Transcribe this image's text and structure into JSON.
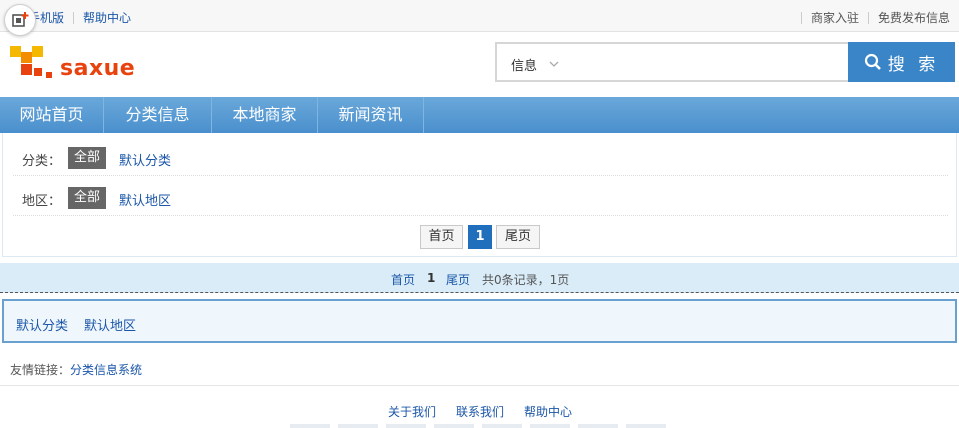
{
  "topbar": {
    "mobile_label": "手机版",
    "help_label": "帮助中心",
    "merchant_join": "商家入驻",
    "free_post": "免费发布信息"
  },
  "header": {
    "logo_text": "saxue",
    "search_category": "信息",
    "search_button": "搜 索",
    "search_placeholder": ""
  },
  "nav": {
    "items": [
      "网站首页",
      "分类信息",
      "本地商家",
      "新闻资讯"
    ]
  },
  "filters": {
    "category": {
      "label": "分类：",
      "all": "全部",
      "option": "默认分类"
    },
    "region": {
      "label": "地区：",
      "all": "全部",
      "option": "默认地区"
    }
  },
  "pager_top": {
    "first": "首页",
    "current": "1",
    "last": "尾页"
  },
  "pager_bar": {
    "first": "首页",
    "current": "1",
    "last": "尾页",
    "summary": "共0条记录，1页"
  },
  "category_links": [
    "默认分类",
    "默认地区"
  ],
  "friend_links": {
    "label": "友情链接：",
    "link": "分类信息系统"
  },
  "footer_links": [
    "关于我们",
    "联系我们",
    "帮助中心"
  ],
  "colors": {
    "nav": "#4a8fcd",
    "search_button": "#3a85c8",
    "accent_link": "#1a56a8",
    "logo": "#e8420f"
  }
}
